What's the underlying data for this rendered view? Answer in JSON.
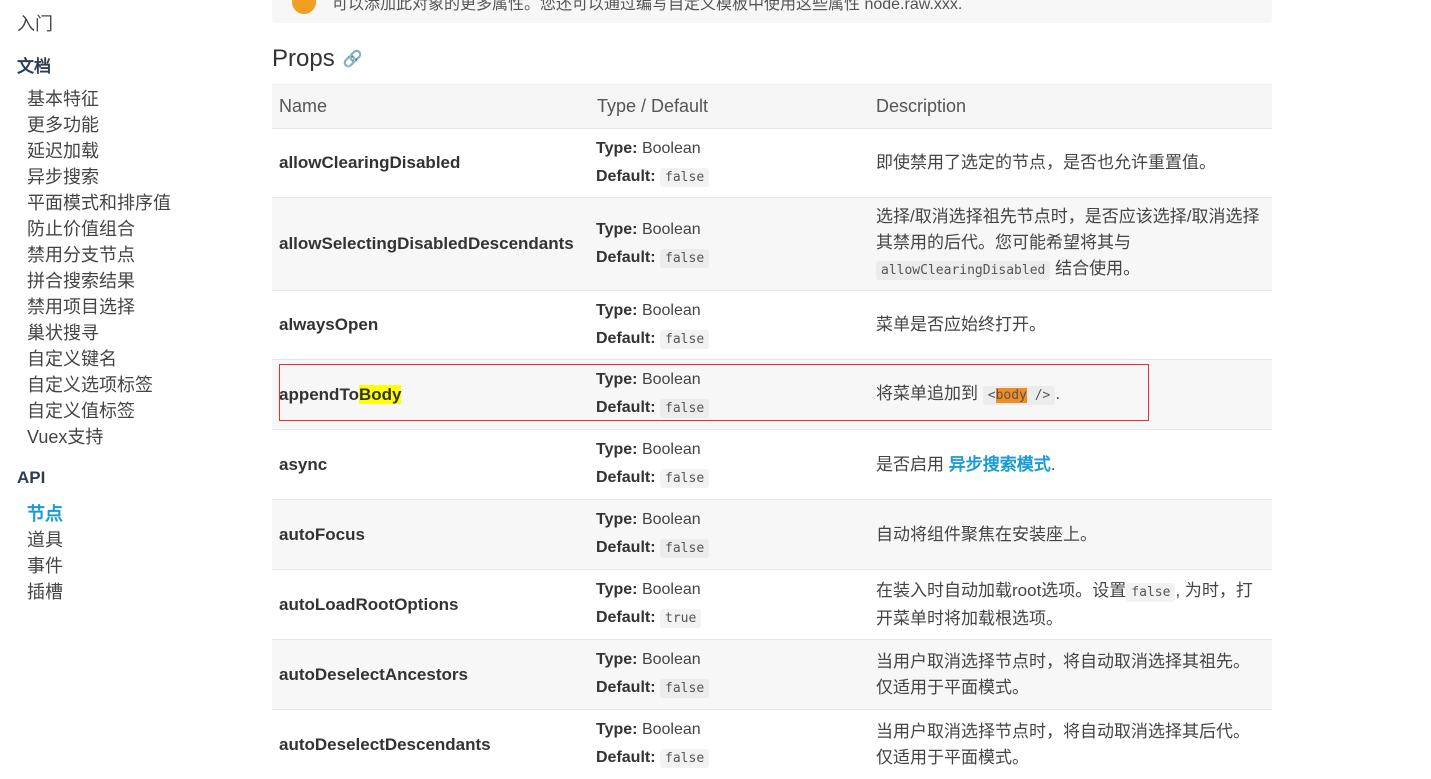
{
  "sidebar": {
    "intro": "入门",
    "docs_title": "文档",
    "docs_items": [
      "基本特征",
      "更多功能",
      "延迟加载",
      "异步搜索",
      "平面模式和排序值",
      "防止价值组合",
      "禁用分支节点",
      "拼合搜索结果",
      "禁用项目选择",
      "巢状搜寻",
      "自定义键名",
      "自定义选项标签",
      "自定义值标签",
      "Vuex支持"
    ],
    "api_title": "API",
    "api_items": [
      "节点",
      "道具",
      "事件",
      "插槽"
    ],
    "api_active_index": 0
  },
  "notice": {
    "text": "可以添加此对象的更多属性。您还可以通过编写自定义模板中使用这些属性 node.raw.xxx."
  },
  "heading": {
    "title": "Props",
    "link_icon": "link-icon"
  },
  "table": {
    "headers": {
      "name": "Name",
      "type": "Type / Default",
      "desc": "Description"
    },
    "type_label": "Type:",
    "default_label": "Default:",
    "rows": [
      {
        "name": "allowClearingDisabled",
        "type": "Boolean",
        "default": "false",
        "desc": "即使禁用了选定的节点，是否也允许重置值。"
      },
      {
        "name": "allowSelectingDisabledDescendants",
        "type": "Boolean",
        "default": "false",
        "desc_pre": "选择/取消选择祖先节点时，是否应该选择/取消选择其禁用的后代。您可能希望将其与 ",
        "desc_code": "allowClearingDisabled",
        "desc_post": " 结合使用。"
      },
      {
        "name": "alwaysOpen",
        "type": "Boolean",
        "default": "false",
        "desc": "菜单是否应始终打开。"
      },
      {
        "name_pre": "appendTo",
        "name_hl": "Body",
        "type": "Boolean",
        "default": "false",
        "desc_pre": "将菜单追加到 ",
        "code_pre": "<",
        "code_hl": "body",
        "code_post": " />",
        "desc_post": "."
      },
      {
        "name": "async",
        "type": "Boolean",
        "default": "false",
        "desc_pre": "是否启用 ",
        "desc_link": "异步搜索模式",
        "desc_post": "."
      },
      {
        "name": "autoFocus",
        "type": "Boolean",
        "default": "false",
        "desc": "自动将组件聚焦在安装座上。"
      },
      {
        "name": "autoLoadRootOptions",
        "type": "Boolean",
        "default": "true",
        "desc_pre": "在装入时自动加载root选项。设置",
        "desc_code": "false",
        "desc_post": ", 为时，打开菜单时将加载根选项。"
      },
      {
        "name": "autoDeselectAncestors",
        "type": "Boolean",
        "default": "false",
        "desc": "当用户取消选择节点时，将自动取消选择其祖先。仅适用于平面模式。"
      },
      {
        "name": "autoDeselectDescendants",
        "type": "Boolean",
        "default": "false",
        "desc": "当用户取消选择节点时，将自动取消选择其后代。仅适用于平面模式。"
      }
    ]
  }
}
